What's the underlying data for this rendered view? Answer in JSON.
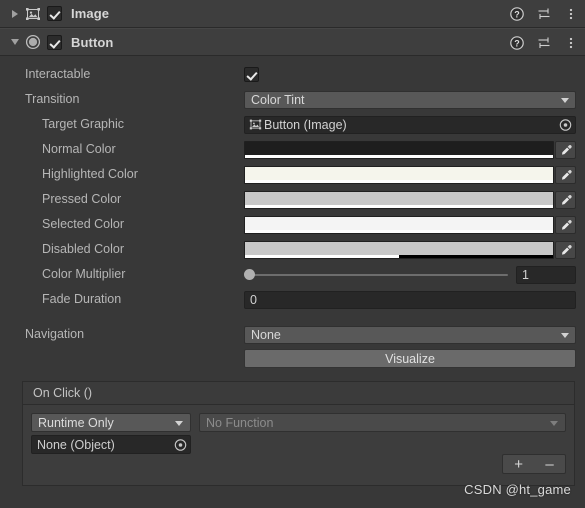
{
  "components": [
    {
      "name": "Image",
      "icon": "image-component-icon",
      "expanded": false,
      "enabled": true,
      "foldout_glyph": "triangle-right"
    },
    {
      "name": "Button",
      "icon": "button-component-icon",
      "expanded": true,
      "enabled": true,
      "foldout_glyph": "triangle-down"
    }
  ],
  "header_icons": {
    "help": "help-icon",
    "preset": "preset-icon",
    "menu": "more-menu-icon"
  },
  "button_component": {
    "interactable": {
      "label": "Interactable",
      "checked": true
    },
    "transition": {
      "label": "Transition",
      "value": "Color Tint"
    },
    "target_graphic": {
      "label": "Target Graphic",
      "value": "Button (Image)"
    },
    "colors": [
      {
        "label": "Normal Color",
        "hex": "#1e1e1e",
        "alpha_pct": 100
      },
      {
        "label": "Highlighted Color",
        "hex": "#f5f5ec",
        "alpha_pct": 100
      },
      {
        "label": "Pressed Color",
        "hex": "#c8c8c8",
        "alpha_pct": 100
      },
      {
        "label": "Selected Color",
        "hex": "#f4f4f4",
        "alpha_pct": 100
      },
      {
        "label": "Disabled Color",
        "hex": "#c8c8c8",
        "alpha_pct": 50
      }
    ],
    "color_multiplier": {
      "label": "Color Multiplier",
      "value": "1",
      "slider_pct": 0,
      "min": 1,
      "max": 5
    },
    "fade_duration": {
      "label": "Fade Duration",
      "value": "0"
    },
    "navigation": {
      "label": "Navigation",
      "value": "None",
      "visualize_label": "Visualize"
    },
    "on_click": {
      "title": "On Click ()",
      "entries": [
        {
          "mode": "Runtime Only",
          "function": "No Function",
          "object": "None (Object)"
        }
      ],
      "add_label": "+",
      "remove_label": "–"
    }
  },
  "watermark": "CSDN @ht_game"
}
